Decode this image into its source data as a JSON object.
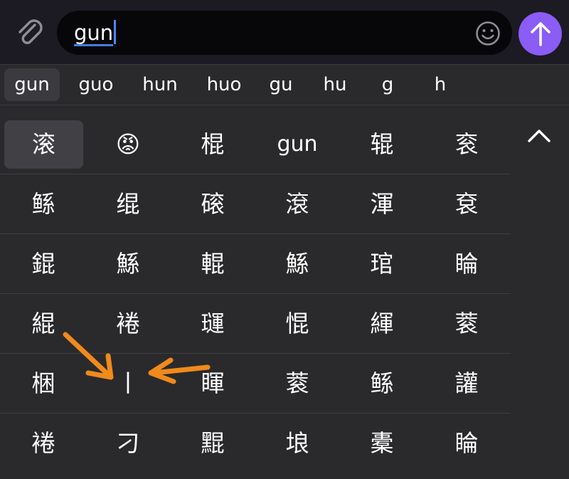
{
  "input": {
    "text": "gun"
  },
  "icons": {
    "attach": "paperclip-icon",
    "emoji": "smiley-icon",
    "send": "arrow-up-icon",
    "collapse": "chevron-up-icon"
  },
  "colors": {
    "send_accent": "#8b5cf6",
    "arrow_annotation": "#f08a1c",
    "caret": "#4d87ff"
  },
  "pinyin": [
    "gun",
    "guo",
    "hun",
    "huo",
    "gu",
    "hu",
    "g",
    "h"
  ],
  "candidates": [
    [
      "滚",
      "😡",
      "棍",
      "gun",
      "辊",
      "衮"
    ],
    [
      "鲧",
      "绲",
      "磙",
      "滾",
      "渾",
      "袞"
    ],
    [
      "錕",
      "鯀",
      "輥",
      "鯀",
      "琯",
      "睔"
    ],
    [
      "緄",
      "裷",
      "璭",
      "惃",
      "緷",
      "蓘"
    ],
    [
      "梱",
      "丨",
      "睴",
      "蓘",
      "鲧",
      "讙"
    ],
    [
      "裷",
      "刁",
      "䵪",
      "埌",
      "橐",
      "睔"
    ]
  ]
}
